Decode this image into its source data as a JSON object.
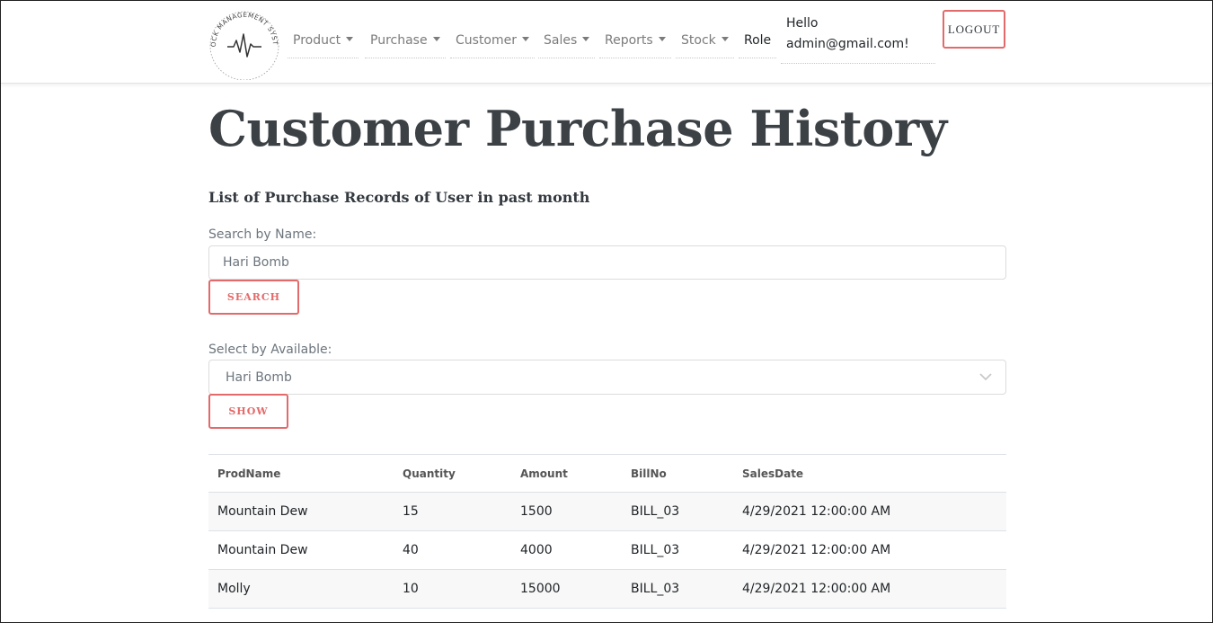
{
  "logo": {
    "text": "STOCK MANAGEMENT SYSTEM",
    "icon": "pulse-icon"
  },
  "nav": {
    "items": [
      {
        "label": "Product",
        "dropdown": true
      },
      {
        "label": "Purchase",
        "dropdown": true
      },
      {
        "label": "Customer",
        "dropdown": true
      },
      {
        "label": "Sales",
        "dropdown": true
      },
      {
        "label": "Reports",
        "dropdown": true
      },
      {
        "label": "Stock",
        "dropdown": true
      },
      {
        "label": "Role",
        "dropdown": false
      }
    ],
    "greeting": "Hello",
    "user": "admin@gmail.com!",
    "logout_label": "LOGOUT"
  },
  "page": {
    "title": "Customer Purchase History",
    "subtitle": "List of Purchase Records of User in past month"
  },
  "search": {
    "label": "Search by Name:",
    "value": "Hari Bomb",
    "button_label": "SEARCH"
  },
  "select": {
    "label": "Select by Available:",
    "selected": "Hari Bomb",
    "button_label": "SHOW"
  },
  "table": {
    "columns": [
      "ProdName",
      "Quantity",
      "Amount",
      "BillNo",
      "SalesDate"
    ],
    "rows": [
      [
        "Mountain Dew",
        "15",
        "1500",
        "BILL_03",
        "4/29/2021 12:00:00 AM"
      ],
      [
        "Mountain Dew",
        "40",
        "4000",
        "BILL_03",
        "4/29/2021 12:00:00 AM"
      ],
      [
        "Molly",
        "10",
        "15000",
        "BILL_03",
        "4/29/2021 12:00:00 AM"
      ]
    ]
  },
  "colors": {
    "accent": "#e36a6a",
    "title": "#3c4146",
    "stripe": "#f7f8f7"
  }
}
